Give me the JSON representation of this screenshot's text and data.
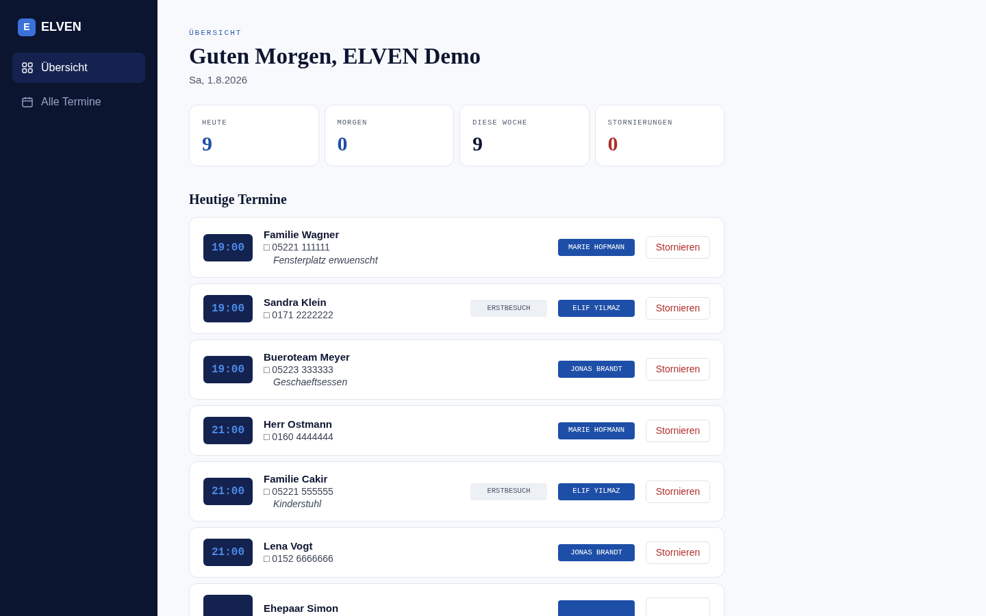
{
  "sidebar": {
    "logo_letter": "E",
    "brand": "ELVEN",
    "items": [
      {
        "label": "Übersicht",
        "selected": true
      },
      {
        "label": "Alle Termine",
        "selected": false
      }
    ]
  },
  "header": {
    "eyebrow": "ÜBERSICHT",
    "title": "Guten Morgen, ELVEN Demo",
    "date": "Sa, 1.8.2026"
  },
  "stats": [
    {
      "label": "HEUTE",
      "value": "9",
      "color": "#1e4fa8"
    },
    {
      "label": "MORGEN",
      "value": "0",
      "color": "#1e4fa8"
    },
    {
      "label": "DIESE WOCHE",
      "value": "9",
      "color": "#0d1530"
    },
    {
      "label": "STORNIERUNGEN",
      "value": "0",
      "color": "#b0302c"
    }
  ],
  "section_title": "Heutige Termine",
  "appointments": [
    {
      "time": "19:00",
      "name": "Familie Wagner",
      "phone": "□ 05221 111111",
      "note": "Fensterplatz erwuenscht",
      "staff": "MARIE HOFMANN",
      "action": "Stornieren"
    },
    {
      "time": "19:00",
      "name": "Sandra Klein",
      "phone": "□ 0171 2222222",
      "tag": "ERSTBESUCH",
      "staff": "ELIF YILMAZ",
      "action": "Stornieren"
    },
    {
      "time": "19:00",
      "name": "Bueroteam Meyer",
      "phone": "□ 05223 333333",
      "note": "Geschaeftsessen",
      "staff": "JONAS BRANDT",
      "action": "Stornieren"
    },
    {
      "time": "21:00",
      "name": "Herr Ostmann",
      "phone": "□ 0160 4444444",
      "staff": "MARIE HOFMANN",
      "action": "Stornieren"
    },
    {
      "time": "21:00",
      "name": "Familie Cakir",
      "phone": "□ 05221 555555",
      "note": "Kinderstuhl",
      "tag": "ERSTBESUCH",
      "staff": "ELIF YILMAZ",
      "action": "Stornieren"
    },
    {
      "time": "21:00",
      "name": "Lena Vogt",
      "phone": "□ 0152 6666666",
      "staff": "JONAS BRANDT",
      "action": "Stornieren"
    },
    {
      "name": "Ehepaar Simon"
    }
  ]
}
